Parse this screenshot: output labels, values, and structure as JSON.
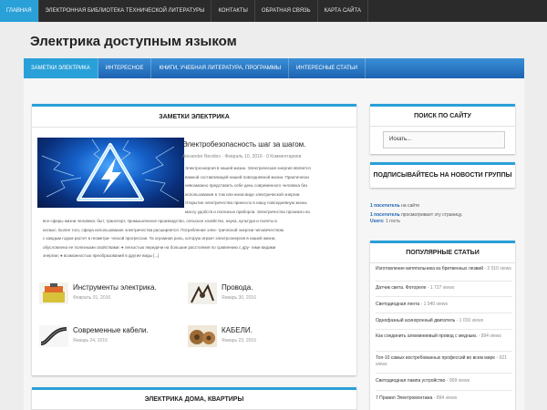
{
  "topnav": {
    "items": [
      "Главная",
      "Электронная библиотека технической литературы",
      "Контакты",
      "Обратная связь",
      "Карта сайта"
    ]
  },
  "site": {
    "title": "Электрика доступным языком"
  },
  "mainnav": {
    "items": [
      "Заметки электрика",
      "Интересное",
      "Книги, учебная литература, программы",
      "Интересные статьи"
    ]
  },
  "notes": {
    "title": "ЗАМЕТКИ ЭЛЕКТРИКА",
    "featured": {
      "title": "Электробезопасность шаг за шагом.",
      "author": "Alexander Nevidov",
      "date": "Февраль 10, 2016",
      "comments": "0 Комментариев",
      "excerpt_lines": [
        "Электроэнергия в нашей жизни. Электрическая энергия является",
        "важной составляющей нашей повседневной жизни. Практически",
        "невозможно представить себе день современного человека без",
        "использования в том или ином виде электрической энергии.",
        "Открытие электричества принесло в нашу повседневную жизнь",
        "массу удобств и полезных приборов. Электричество проникло во",
        "все сферы жизни человека: быт, транспорт, промышленное производство, сельское хозяйство, наука, культура и полеты в",
        "космос. Более того, сфера использования электричества расширяется. Потребление элек- трической энергии человечеством",
        "с каждым годом растет в геометри- ческой прогрессии. Та огромная роль, которую играет электроэнергия в нашей жизни,",
        "обусловлена ее полезными свойствами: ● легкостью передачи на большие расстояния по сравнению с дру- гими видами",
        "энергии; ● возможностью преобразований в другие виды [...]"
      ]
    },
    "posts": [
      {
        "title": "Инструменты электрика.",
        "date": "Февраль 01, 2016"
      },
      {
        "title": "Провода.",
        "date": "Январь 30, 2016"
      },
      {
        "title": "Современные кабели.",
        "date": "Январь 24, 2016"
      },
      {
        "title": "КАБЕЛИ.",
        "date": "Январь 23, 2016"
      }
    ]
  },
  "home": {
    "title": "ЭЛЕКТРИКА ДОМА, КВАРТИРЫ"
  },
  "sidebar": {
    "search": {
      "title": "ПОИСК ПО САЙТУ",
      "placeholder": "Искать..."
    },
    "subscribe": {
      "title": "ПОДПИСЫВАЙТЕСЬ НА НОВОСТИ ГРУППЫ"
    },
    "stats": [
      {
        "count": "1 посетитель",
        "text": " на сайте"
      },
      {
        "count": "1 посетитель",
        "text": " просматривает эту страницу."
      },
      {
        "count": "Users: ",
        "text": "1 гость"
      }
    ],
    "popular": {
      "title": "ПОПУЛЯРНЫЕ СТАТЬИ",
      "items": [
        {
          "title": "Изготовление кипятильника из бритвенных лезвий",
          "views": "- 2 010 views"
        },
        {
          "title": "Датчик света. Фотореле",
          "views": "- 1 727 views"
        },
        {
          "title": "Светодиодная лента",
          "views": "- 1 040 views"
        },
        {
          "title": "Однофазный асинхронный двигатель",
          "views": "- 1 016 views"
        },
        {
          "title": "Как соединить алюминиевый провод с медным.",
          "views": "- 994 views"
        },
        {
          "title": "Топ-10 самых востребованных профессий во всем мире",
          "views": "- 921 views"
        },
        {
          "title": "Светодиодная лампа устройство",
          "views": "- 909 views"
        },
        {
          "title": "7 Правил Электромонтажа",
          "views": "- 894 views"
        }
      ]
    }
  }
}
